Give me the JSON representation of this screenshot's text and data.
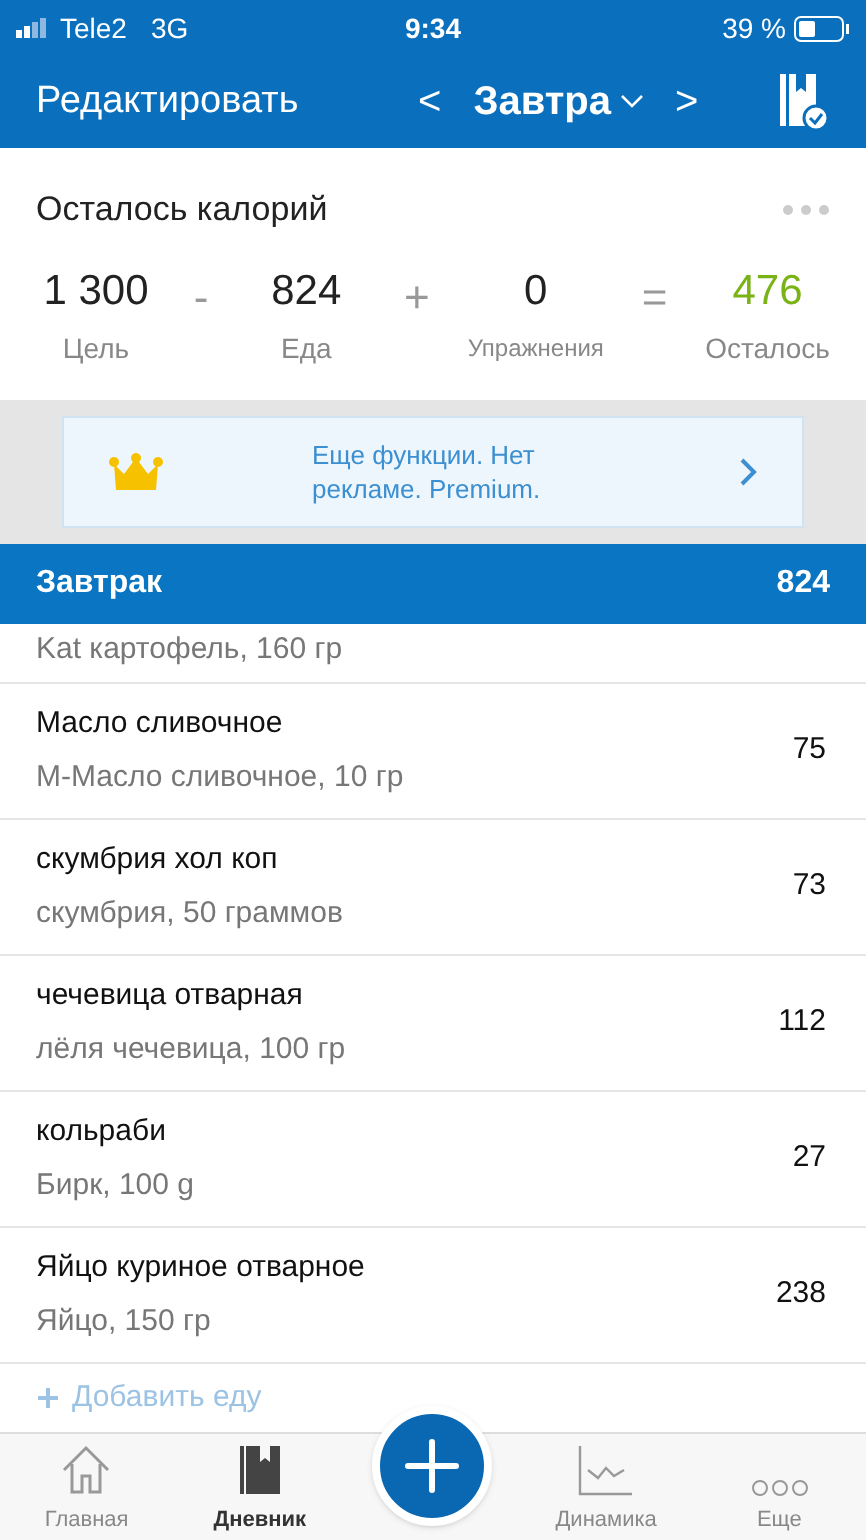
{
  "status_bar": {
    "carrier": "Tele2",
    "network": "3G",
    "time": "9:34",
    "battery": "39 %"
  },
  "nav": {
    "edit": "Редактировать",
    "prev": "<",
    "date": "Завтра",
    "next": ">"
  },
  "summary": {
    "title": "Осталось калорий",
    "terms": [
      {
        "kind": "value",
        "value": "1 300",
        "label": "Цель"
      },
      {
        "kind": "operator",
        "value": "-"
      },
      {
        "kind": "value",
        "value": "824",
        "label": "Еда"
      },
      {
        "kind": "operator",
        "value": "+"
      },
      {
        "kind": "value",
        "value": "0",
        "label": "Упражнения"
      },
      {
        "kind": "operator",
        "value": "="
      },
      {
        "kind": "result",
        "value": "476",
        "label": "Осталось"
      }
    ]
  },
  "promo": {
    "text": "Еще функции. Нет рекламе. Premium."
  },
  "meal": {
    "name": "Завтрак",
    "calories": "824"
  },
  "partial_entry": {
    "detail": "Kat картофель, 160 гр"
  },
  "entries": [
    {
      "name": "Масло сливочное",
      "detail": "М-Масло сливочное, 10 гр",
      "calories": "75"
    },
    {
      "name": "скумбрия хол коп",
      "detail": "скумбрия, 50 граммов",
      "calories": "73"
    },
    {
      "name": "чечевица отварная",
      "detail": "лёля чечевица, 100 гр",
      "calories": "112"
    },
    {
      "name": "кольраби",
      "detail": "Бирк, 100 g",
      "calories": "27"
    },
    {
      "name": "Яйцо куриное отварное",
      "detail": "Яйцо, 150 гр",
      "calories": "238"
    }
  ],
  "add_food": "Добавить еду",
  "tabs": [
    {
      "kind": "home",
      "label": "Главная",
      "selected": false
    },
    {
      "kind": "diary",
      "label": "Дневник",
      "selected": true
    },
    {
      "kind": "add"
    },
    {
      "kind": "progress",
      "label": "Динамика",
      "selected": false
    },
    {
      "kind": "more",
      "label": "Еще",
      "selected": false
    }
  ]
}
